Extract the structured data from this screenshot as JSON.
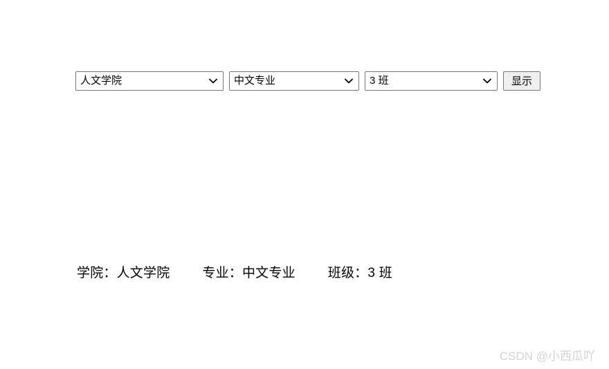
{
  "form": {
    "college_select": {
      "selected": "人文学院",
      "options": [
        "人文学院"
      ]
    },
    "major_select": {
      "selected": "中文专业",
      "options": [
        "中文专业"
      ]
    },
    "class_select": {
      "selected": "3 班",
      "options": [
        "3 班"
      ]
    },
    "display_button_label": "显示",
    "dropdown_icon": "chevron-down-icon"
  },
  "result": {
    "college_text": "学院：人文学院",
    "major_text": "专业：中文专业",
    "class_text": "班级：3 班"
  },
  "watermark": {
    "text": "CSDN @小西瓜吖",
    "color": "#d2d2d2"
  }
}
